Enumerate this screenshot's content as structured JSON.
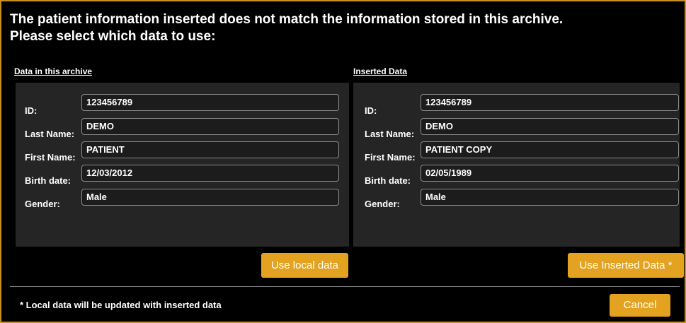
{
  "header": {
    "line1": "The patient information inserted does not match the information stored in this archive.",
    "line2": "Please select which data to use:"
  },
  "local": {
    "title": "Data in this archive",
    "labels": [
      "ID:",
      "Last Name:",
      "First Name:",
      "Birth date:",
      "Gender:"
    ],
    "values": [
      "123456789",
      "DEMO",
      "PATIENT",
      "12/03/2012",
      "Male"
    ],
    "button": "Use local data"
  },
  "inserted": {
    "title": "Inserted Data",
    "labels": [
      "ID:",
      "Last Name:",
      "First Name:",
      "Birth date:",
      "Gender:"
    ],
    "values": [
      "123456789",
      "DEMO",
      "PATIENT COPY",
      "02/05/1989",
      "Male"
    ],
    "button": "Use Inserted Data *"
  },
  "footer": {
    "note": "* Local data will be updated with inserted data",
    "cancel": "Cancel"
  },
  "colors": {
    "accent": "#e3a321",
    "border": "#c8901a",
    "panel": "#252525"
  }
}
